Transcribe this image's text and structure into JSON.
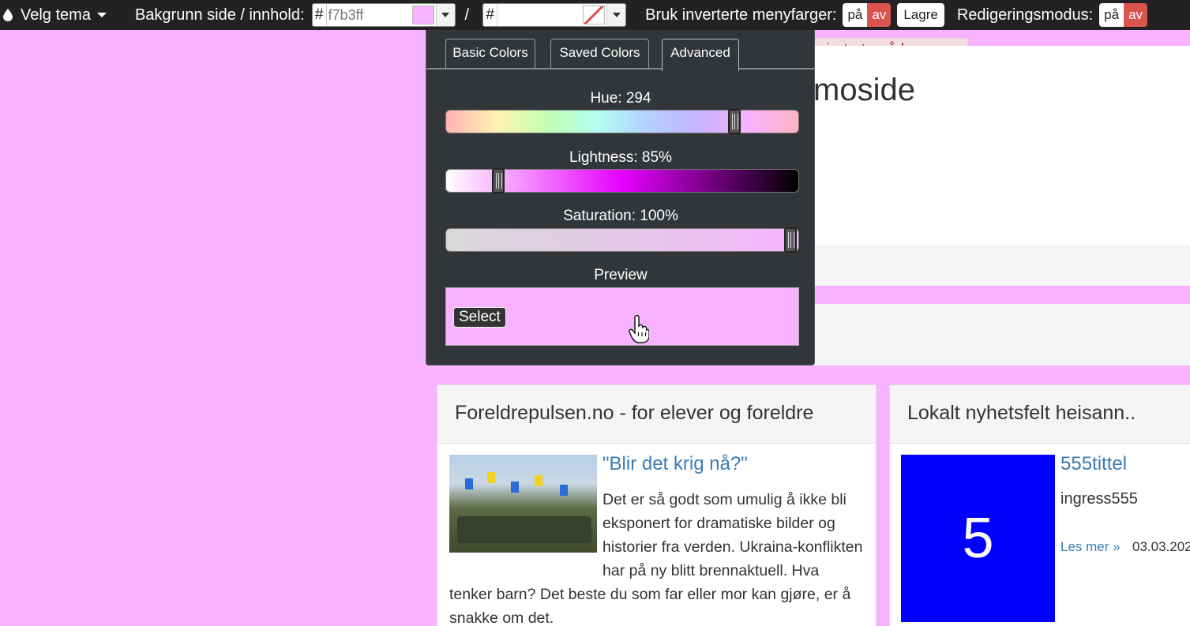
{
  "toolbar": {
    "theme_label": "Velg tema",
    "bg_label": "Bakgrunn side / innhold:",
    "page_color": {
      "hash": "#",
      "value": "f7b3ff",
      "swatch": "#f7b3ff"
    },
    "separator": "/",
    "content_color": {
      "hash": "#",
      "value": ""
    },
    "invert_label": "Bruk inverterte menyfarger:",
    "invert_on": "på",
    "invert_off": "av",
    "save_label": "Lagre",
    "edit_label": "Redigeringsmodus:",
    "edit_on": "på",
    "edit_off": "av"
  },
  "picker": {
    "tabs": [
      "Basic Colors",
      "Saved Colors",
      "Advanced"
    ],
    "active_tab": "Advanced",
    "hue_label": "Hue: 294",
    "hue_value": 294,
    "lightness_label": "Lightness: 85%",
    "lightness_value": 85,
    "saturation_label": "Saturation: 100%",
    "saturation_value": 100,
    "preview_label": "Preview",
    "select_label": "Select"
  },
  "page": {
    "warning": "gjort uten å lagre",
    "hero_title": "moside",
    "panel1": {
      "title": "Foreldrepulsen.no - for elever og foreldre",
      "article_title": "\"Blir det krig nå?\"",
      "article_text": "Det er så godt som umulig å ikke bli eksponert for dramatiske bilder og historier fra verden. Ukraina-konflikten har på ny blitt brennaktuell. Hva tenker barn? Det beste du som far eller mor kan gjøre, er å snakke om det."
    },
    "panel2": {
      "title": "Lokalt nyhetsfelt heisann..",
      "image_text": "5",
      "article_title": "555tittel",
      "ingress": "ingress555",
      "more": "Les mer »",
      "date": "03.03.202"
    }
  }
}
